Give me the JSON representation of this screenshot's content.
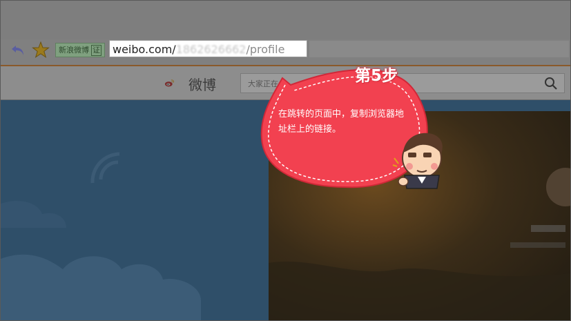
{
  "browser": {
    "site_badge": "新浪微博",
    "cert_label": "证",
    "url": {
      "host": "weibo.com/",
      "hidden_id": "1862626662",
      "path": "/profile"
    }
  },
  "weibo": {
    "logo_text": "微博",
    "search_placeholder": "大家正在"
  },
  "callout": {
    "step_title": "第5步",
    "text": "在跳转的页面中，复制浏览器地址栏上的链接。",
    "bubble_color": "#f24150"
  }
}
